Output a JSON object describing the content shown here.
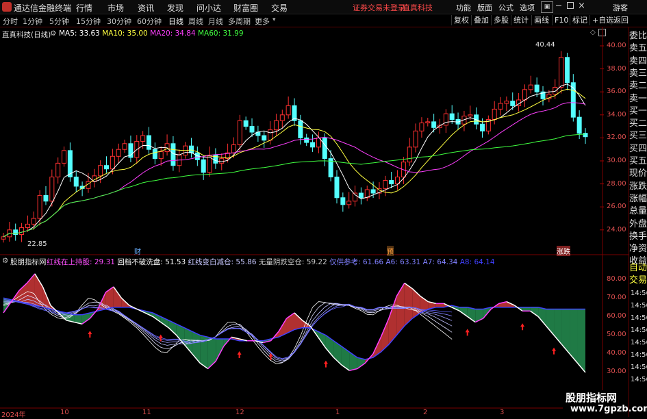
{
  "titlebar": {
    "app_title": "通达信金融终端",
    "menu": [
      "行情",
      "市场",
      "资讯",
      "发现",
      "问小达",
      "财富圈",
      "交易"
    ],
    "warning": "证券交易未登录",
    "stock_name": "直真科技",
    "right_menu": [
      "功能",
      "版面",
      "公式",
      "选项"
    ],
    "guest": "游客"
  },
  "periods": [
    "分时",
    "1分钟",
    "5分钟",
    "15分钟",
    "30分钟",
    "60分钟",
    "日线",
    "周线",
    "月线",
    "多周期",
    "更多"
  ],
  "active_period": "日线",
  "toolbar_buttons": [
    "复权",
    "叠加",
    "多股",
    "统计",
    "画线",
    "F10",
    "标记",
    "+自选",
    "返回"
  ],
  "main_chart": {
    "stock_label": "直真科技(日线)",
    "ma": [
      {
        "label": "MA5: 33.63",
        "color": "#ffffff"
      },
      {
        "label": "MA10: 35.00",
        "color": "#ffff40"
      },
      {
        "label": "MA20: 34.84",
        "color": "#ff40ff"
      },
      {
        "label": "MA60: 31.99",
        "color": "#40ff40"
      }
    ],
    "y_ticks": [
      "40.00",
      "38.00",
      "36.00",
      "34.00",
      "32.00",
      "30.00",
      "28.00",
      "26.00",
      "24.00"
    ],
    "high_label": "40.44",
    "low_label": "22.85",
    "event_markers": [
      "财",
      "预",
      "涨跌"
    ]
  },
  "indicator": {
    "name": "股朋指标网",
    "items": [
      {
        "label": "红线在上持股: 29.31",
        "color": "#ff50ff"
      },
      {
        "label": "回档不破洗盘: 51.53",
        "color": "#ffffff"
      },
      {
        "label": "红线变白减仓: 55.86",
        "color": "#c8c8ff"
      },
      {
        "label": "无量阴跌空仓: 59.22",
        "color": "#c8c8c8"
      },
      {
        "label": "仅供参考: 61.66",
        "color": "#8080ff"
      },
      {
        "label": "A6: 63.31",
        "color": "#8080ff"
      },
      {
        "label": "A7: 64.34",
        "color": "#8080ff"
      },
      {
        "label": "A8: 64.14",
        "color": "#4040ff"
      }
    ],
    "y_ticks": [
      "80.00",
      "70.00",
      "60.00",
      "50.00",
      "40.00",
      "30.00"
    ]
  },
  "x_axis": [
    "2024年",
    "10",
    "11",
    "12",
    "1",
    "2",
    "3"
  ],
  "side_tabs": [
    "委比",
    "卖五",
    "卖四",
    "卖三",
    "卖二",
    "卖一",
    "买一",
    "买二",
    "买三",
    "买四",
    "买五",
    "现价",
    "涨跌",
    "涨幅",
    "总量",
    "外盘",
    "换手",
    "净资",
    "收益"
  ],
  "side_tabs_lower": [
    "自动",
    "交易"
  ],
  "time_labels": [
    "14:56",
    "14:56",
    "14:56",
    "14:56",
    "14:56",
    "14:56",
    "14:56",
    "14:56"
  ],
  "watermark": {
    "line1": "股朋指标网",
    "line2": "www.7gpzb.com"
  },
  "chart_data": [
    {
      "type": "candlestick",
      "y_axis_range": [
        23,
        41
      ],
      "last_values": {
        "MA5": 33.63,
        "MA10": 35.0,
        "MA20": 34.84,
        "MA60": 31.99
      },
      "high": 40.44,
      "low": 22.85,
      "close_series": [
        23.4,
        24.0,
        23.6,
        24.2,
        24.5,
        25.0,
        27.0,
        26.5,
        28.6,
        29.8,
        30.9,
        28.6,
        27.8,
        27.6,
        28.2,
        28.7,
        29.6,
        29.3,
        30.4,
        31.0,
        31.5,
        30.3,
        31.7,
        32.2,
        31.0,
        30.2,
        30.8,
        31.5,
        29.6,
        30.5,
        31.3,
        30.7,
        30.1,
        29.0,
        30.5,
        29.8,
        30.2,
        30.7,
        31.4,
        33.5,
        33.0,
        32.5,
        32.2,
        31.8,
        32.7,
        33.5,
        34.0,
        34.8,
        33.5,
        32.0,
        31.6,
        31.2,
        32.0,
        30.2,
        28.6,
        26.8,
        26.2,
        26.5,
        27.2,
        26.8,
        27.5,
        27.2,
        27.6,
        28.3,
        28.0,
        28.6,
        29.9,
        31.2,
        32.6,
        33.3,
        33.4,
        32.9,
        33.1,
        34.1,
        33.6,
        33.2,
        33.9,
        34.0,
        33.2,
        32.6,
        33.6,
        34.5,
        35.0,
        35.2,
        34.8,
        35.3,
        36.2,
        36.6,
        36.0,
        35.4,
        35.8,
        36.4,
        39.0,
        36.8,
        33.8,
        32.4,
        32.1
      ],
      "x_labels": [
        "2024年",
        "10",
        "11",
        "12",
        "1",
        "2",
        "3"
      ]
    },
    {
      "type": "area",
      "y_axis_range": [
        25,
        85
      ],
      "series": [
        {
          "name": "红线在上持股",
          "values": [
            62,
            68,
            74,
            78,
            83,
            76,
            66,
            62,
            58,
            57,
            56,
            59,
            64,
            73,
            76,
            70,
            66,
            64,
            62,
            60,
            57,
            54,
            50,
            45,
            40,
            35,
            32,
            36,
            44,
            49,
            48,
            47,
            47,
            46,
            47,
            52,
            59,
            62,
            58,
            55,
            49,
            43,
            38,
            34,
            31,
            32,
            35,
            40,
            49,
            59,
            71,
            78,
            75,
            71,
            68,
            67,
            67,
            65,
            63,
            60,
            57,
            59,
            64,
            67,
            68,
            66,
            63,
            63,
            60,
            55,
            50,
            45,
            40,
            35,
            30
          ]
        },
        {
          "name": "A8",
          "values": [
            70,
            69,
            68,
            67,
            66,
            65,
            64,
            63,
            62,
            61,
            61,
            62,
            63,
            64,
            65,
            65,
            65,
            64,
            63,
            62,
            60,
            58,
            56,
            54,
            52,
            50,
            49,
            48,
            48,
            48,
            47,
            47,
            47,
            47,
            48,
            49,
            51,
            53,
            54,
            54,
            52,
            50,
            47,
            44,
            41,
            38,
            37,
            38,
            41,
            45,
            50,
            55,
            59,
            62,
            64,
            65,
            65,
            66,
            65,
            65,
            64,
            64,
            65,
            65,
            65,
            65,
            65,
            65,
            65,
            64,
            64,
            64,
            64,
            64,
            64
          ]
        }
      ]
    }
  ]
}
